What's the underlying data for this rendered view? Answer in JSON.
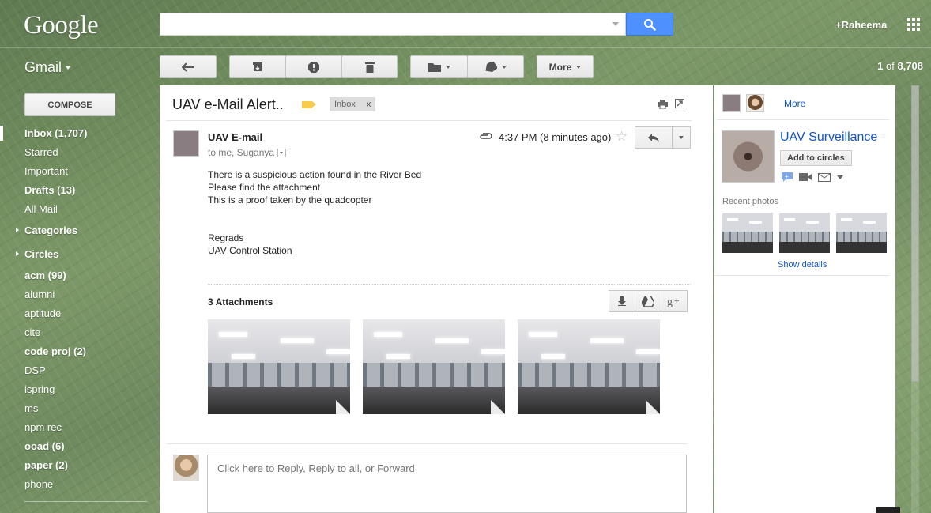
{
  "header": {
    "logo": "Google",
    "search_placeholder": "",
    "user": "+Raheema"
  },
  "app": {
    "name": "Gmail"
  },
  "toolbar": {
    "more_label": "More",
    "page_current": "1",
    "page_of": "of",
    "page_total": "8,708"
  },
  "compose_label": "COMPOSE",
  "nav": {
    "inbox": "Inbox (1,707)",
    "starred": "Starred",
    "important": "Important",
    "drafts": "Drafts (13)",
    "all_mail": "All Mail",
    "categories": "Categories",
    "circles": "Circles",
    "labels": [
      "acm (99)",
      "alumni",
      "aptitude",
      "cite",
      "code proj (2)",
      "DSP",
      "ispring",
      "ms",
      "npm rec",
      "ooad (6)",
      "paper (2)",
      "phone"
    ]
  },
  "thread": {
    "subject": "UAV e-Mail Alert..",
    "label_chip": "Inbox",
    "label_chip_close": "x",
    "sender": "UAV E-mail",
    "recipients": "to me, Suganya",
    "time": "4:37 PM (8 minutes ago)",
    "body": [
      "There is a suspicious action found in the River Bed",
      "Please find the attachment",
      "This is a proof taken by the quadcopter",
      "",
      "Regrads",
      "UAV Control Station"
    ],
    "attachments_title": "3 Attachments",
    "reply_prompt_prefix": "Click here to ",
    "reply_link": "Reply",
    "reply_sep1": ", ",
    "reply_all_link": "Reply to all",
    "reply_sep2": ", or ",
    "forward_link": "Forward"
  },
  "sidebar": {
    "more_link": "More",
    "contact_name": "UAV Surveillance",
    "add_circles": "Add to circles",
    "recent_photos": "Recent photos",
    "show_details": "Show details"
  },
  "colors": {
    "accent_blue": "#4d90fe",
    "link_blue": "#1155cc",
    "label_yellow": "#f7cb4d"
  }
}
